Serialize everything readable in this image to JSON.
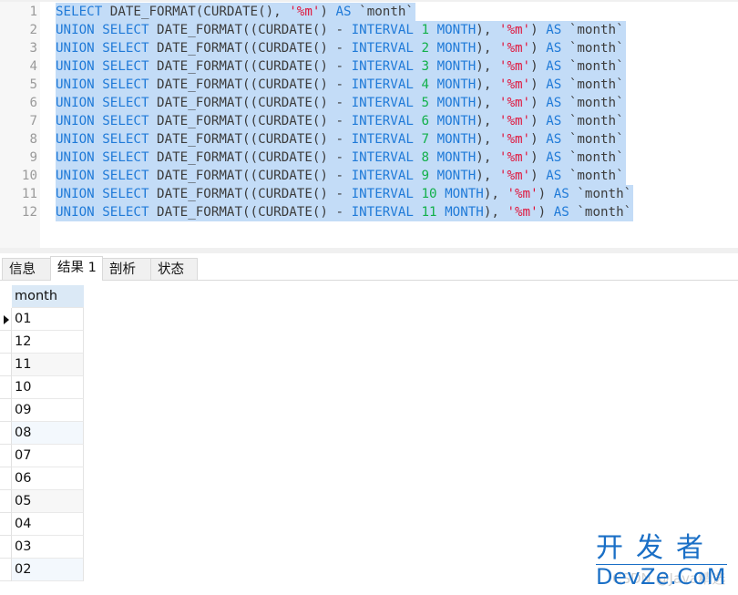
{
  "editor": {
    "lines": [
      {
        "no": "1",
        "parts": [
          [
            "kw",
            "SELECT"
          ],
          [
            "fn",
            " DATE_FORMAT(CURDATE(), "
          ],
          [
            "str",
            "'%m'"
          ],
          [
            "fn",
            ") "
          ],
          [
            "kw",
            "AS"
          ],
          [
            "id",
            " `month`"
          ]
        ]
      },
      {
        "no": "2",
        "parts": [
          [
            "kw",
            "UNION SELECT"
          ],
          [
            "fn",
            " DATE_FORMAT((CURDATE() - "
          ],
          [
            "kw",
            "INTERVAL"
          ],
          [
            "fn",
            " "
          ],
          [
            "num",
            "1"
          ],
          [
            "fn",
            " "
          ],
          [
            "kw",
            "MONTH"
          ],
          [
            "fn",
            "), "
          ],
          [
            "str",
            "'%m'"
          ],
          [
            "fn",
            ") "
          ],
          [
            "kw",
            "AS"
          ],
          [
            "id",
            " `month`"
          ]
        ]
      },
      {
        "no": "3",
        "parts": [
          [
            "kw",
            "UNION SELECT"
          ],
          [
            "fn",
            " DATE_FORMAT((CURDATE() - "
          ],
          [
            "kw",
            "INTERVAL"
          ],
          [
            "fn",
            " "
          ],
          [
            "num",
            "2"
          ],
          [
            "fn",
            " "
          ],
          [
            "kw",
            "MONTH"
          ],
          [
            "fn",
            "), "
          ],
          [
            "str",
            "'%m'"
          ],
          [
            "fn",
            ") "
          ],
          [
            "kw",
            "AS"
          ],
          [
            "id",
            " `month`"
          ]
        ]
      },
      {
        "no": "4",
        "parts": [
          [
            "kw",
            "UNION SELECT"
          ],
          [
            "fn",
            " DATE_FORMAT((CURDATE() - "
          ],
          [
            "kw",
            "INTERVAL"
          ],
          [
            "fn",
            " "
          ],
          [
            "num",
            "3"
          ],
          [
            "fn",
            " "
          ],
          [
            "kw",
            "MONTH"
          ],
          [
            "fn",
            "), "
          ],
          [
            "str",
            "'%m'"
          ],
          [
            "fn",
            ") "
          ],
          [
            "kw",
            "AS"
          ],
          [
            "id",
            " `month`"
          ]
        ]
      },
      {
        "no": "5",
        "parts": [
          [
            "kw",
            "UNION SELECT"
          ],
          [
            "fn",
            " DATE_FORMAT((CURDATE() - "
          ],
          [
            "kw",
            "INTERVAL"
          ],
          [
            "fn",
            " "
          ],
          [
            "num",
            "4"
          ],
          [
            "fn",
            " "
          ],
          [
            "kw",
            "MONTH"
          ],
          [
            "fn",
            "), "
          ],
          [
            "str",
            "'%m'"
          ],
          [
            "fn",
            ") "
          ],
          [
            "kw",
            "AS"
          ],
          [
            "id",
            " `month`"
          ]
        ]
      },
      {
        "no": "6",
        "parts": [
          [
            "kw",
            "UNION SELECT"
          ],
          [
            "fn",
            " DATE_FORMAT((CURDATE() - "
          ],
          [
            "kw",
            "INTERVAL"
          ],
          [
            "fn",
            " "
          ],
          [
            "num",
            "5"
          ],
          [
            "fn",
            " "
          ],
          [
            "kw",
            "MONTH"
          ],
          [
            "fn",
            "), "
          ],
          [
            "str",
            "'%m'"
          ],
          [
            "fn",
            ") "
          ],
          [
            "kw",
            "AS"
          ],
          [
            "id",
            " `month`"
          ]
        ]
      },
      {
        "no": "7",
        "parts": [
          [
            "kw",
            "UNION SELECT"
          ],
          [
            "fn",
            " DATE_FORMAT((CURDATE() - "
          ],
          [
            "kw",
            "INTERVAL"
          ],
          [
            "fn",
            " "
          ],
          [
            "num",
            "6"
          ],
          [
            "fn",
            " "
          ],
          [
            "kw",
            "MONTH"
          ],
          [
            "fn",
            "), "
          ],
          [
            "str",
            "'%m'"
          ],
          [
            "fn",
            ") "
          ],
          [
            "kw",
            "AS"
          ],
          [
            "id",
            " `month`"
          ]
        ]
      },
      {
        "no": "8",
        "parts": [
          [
            "kw",
            "UNION SELECT"
          ],
          [
            "fn",
            " DATE_FORMAT((CURDATE() - "
          ],
          [
            "kw",
            "INTERVAL"
          ],
          [
            "fn",
            " "
          ],
          [
            "num",
            "7"
          ],
          [
            "fn",
            " "
          ],
          [
            "kw",
            "MONTH"
          ],
          [
            "fn",
            "), "
          ],
          [
            "str",
            "'%m'"
          ],
          [
            "fn",
            ") "
          ],
          [
            "kw",
            "AS"
          ],
          [
            "id",
            " `month`"
          ]
        ]
      },
      {
        "no": "9",
        "parts": [
          [
            "kw",
            "UNION SELECT"
          ],
          [
            "fn",
            " DATE_FORMAT((CURDATE() - "
          ],
          [
            "kw",
            "INTERVAL"
          ],
          [
            "fn",
            " "
          ],
          [
            "num",
            "8"
          ],
          [
            "fn",
            " "
          ],
          [
            "kw",
            "MONTH"
          ],
          [
            "fn",
            "), "
          ],
          [
            "str",
            "'%m'"
          ],
          [
            "fn",
            ") "
          ],
          [
            "kw",
            "AS"
          ],
          [
            "id",
            " `month`"
          ]
        ]
      },
      {
        "no": "10",
        "parts": [
          [
            "kw",
            "UNION SELECT"
          ],
          [
            "fn",
            " DATE_FORMAT((CURDATE() - "
          ],
          [
            "kw",
            "INTERVAL"
          ],
          [
            "fn",
            " "
          ],
          [
            "num",
            "9"
          ],
          [
            "fn",
            " "
          ],
          [
            "kw",
            "MONTH"
          ],
          [
            "fn",
            "), "
          ],
          [
            "str",
            "'%m'"
          ],
          [
            "fn",
            ") "
          ],
          [
            "kw",
            "AS"
          ],
          [
            "id",
            " `month`"
          ]
        ]
      },
      {
        "no": "11",
        "parts": [
          [
            "kw",
            "UNION SELECT"
          ],
          [
            "fn",
            " DATE_FORMAT((CURDATE() - "
          ],
          [
            "kw",
            "INTERVAL"
          ],
          [
            "fn",
            " "
          ],
          [
            "num",
            "10"
          ],
          [
            "fn",
            " "
          ],
          [
            "kw",
            "MONTH"
          ],
          [
            "fn",
            "), "
          ],
          [
            "str",
            "'%m'"
          ],
          [
            "fn",
            ") "
          ],
          [
            "kw",
            "AS"
          ],
          [
            "id",
            " `month`"
          ]
        ]
      },
      {
        "no": "12",
        "parts": [
          [
            "kw",
            "UNION SELECT"
          ],
          [
            "fn",
            " DATE_FORMAT((CURDATE() - "
          ],
          [
            "kw",
            "INTERVAL"
          ],
          [
            "fn",
            " "
          ],
          [
            "num",
            "11"
          ],
          [
            "fn",
            " "
          ],
          [
            "kw",
            "MONTH"
          ],
          [
            "fn",
            "), "
          ],
          [
            "str",
            "'%m'"
          ],
          [
            "fn",
            ") "
          ],
          [
            "kw",
            "AS"
          ],
          [
            "id",
            " `month`"
          ]
        ]
      }
    ]
  },
  "tabs": [
    {
      "label": "信息",
      "active": false
    },
    {
      "label": "结果 1",
      "active": true
    },
    {
      "label": "剖析",
      "active": false
    },
    {
      "label": "状态",
      "active": false
    }
  ],
  "grid": {
    "columns": [
      "month"
    ],
    "rows": [
      "01",
      "12",
      "11",
      "10",
      "09",
      "08",
      "07",
      "06",
      "05",
      "04",
      "03",
      "02"
    ],
    "current_row": 0
  },
  "watermark": {
    "cn": "开发者",
    "en": "DevZe.CoM",
    "faint": "CSDN @Java精选"
  },
  "colors": {
    "keyword": "#1f7ad8",
    "number": "#12b04a",
    "string": "#e0163c",
    "selection": "#c3dcf7",
    "header": "#dbe9f6"
  }
}
